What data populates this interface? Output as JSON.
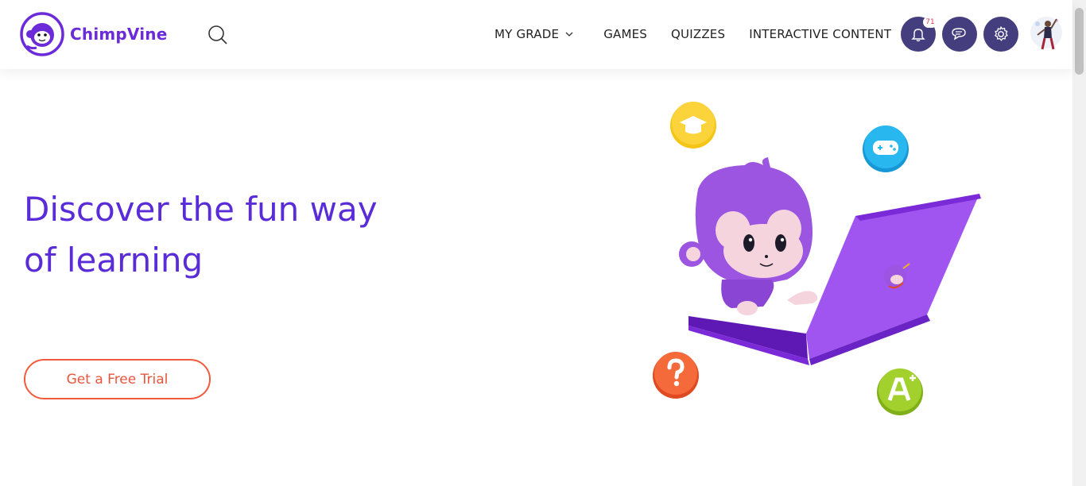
{
  "brand": {
    "name": "ChimpVine",
    "primary_color": "#6c2bd9"
  },
  "nav": {
    "items": [
      {
        "label": "MY GRADE",
        "has_dropdown": true
      },
      {
        "label": "GAMES"
      },
      {
        "label": "QUIZZES"
      },
      {
        "label": "INTERACTIVE CONTENT"
      }
    ]
  },
  "header_actions": {
    "notifications_count": "71",
    "buttons": [
      "bell-icon",
      "chat-icon",
      "gear-icon"
    ],
    "button_color": "#453e7e"
  },
  "hero": {
    "title_line1": "Discover the fun way",
    "title_line2": "of learning",
    "cta_label": "Get a Free Trial",
    "title_color": "#5a2cd8",
    "cta_color": "#f15a3c",
    "floating_icons": [
      "graduation-cap-icon",
      "gamepad-icon",
      "question-mark-icon",
      "a-plus-icon"
    ]
  }
}
